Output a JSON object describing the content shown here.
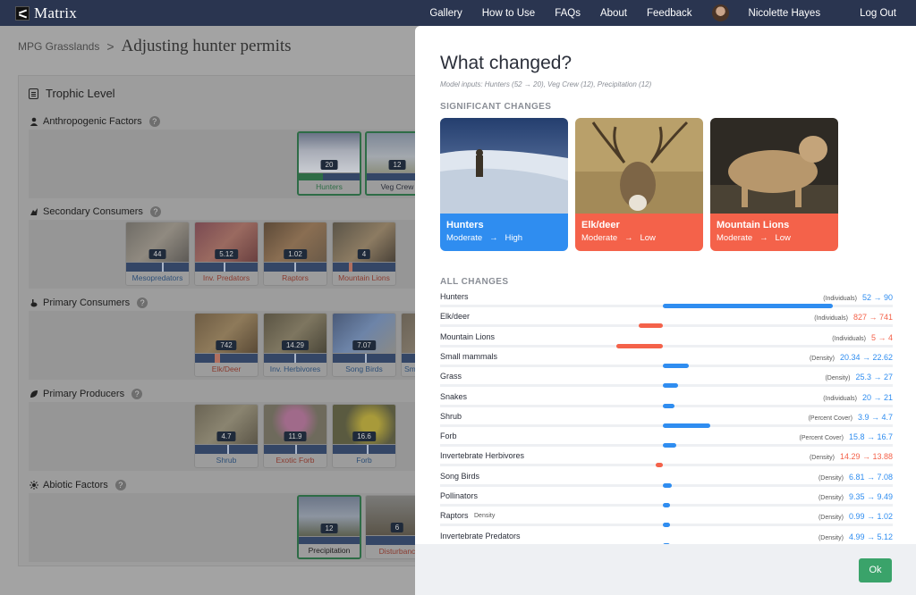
{
  "app": {
    "name": "Matrix"
  },
  "nav": {
    "items": [
      "Gallery",
      "How to Use",
      "FAQs",
      "About",
      "Feedback"
    ],
    "user_name": "Nicolette Hayes",
    "logout": "Log Out"
  },
  "breadcrumb": {
    "parent": "MPG Grasslands",
    "separator": ">",
    "current": "Adjusting hunter permits"
  },
  "trophic": {
    "title": "Trophic Level",
    "help": "?",
    "sections": [
      {
        "label": "Anthropogenic Factors"
      },
      {
        "label": "Secondary Consumers"
      },
      {
        "label": "Primary Consumers"
      },
      {
        "label": "Primary Producers"
      },
      {
        "label": "Abiotic Factors"
      }
    ],
    "tiles": {
      "anthro": [
        {
          "value": "20",
          "label": "Hunters"
        },
        {
          "value": "12",
          "label": "Veg Crew"
        }
      ],
      "secondary": [
        {
          "value": "44",
          "label": "Mesopredators"
        },
        {
          "value": "5.12",
          "label": "Inv. Predators"
        },
        {
          "value": "1.02",
          "label": "Raptors"
        },
        {
          "value": "4",
          "label": "Mountain Lions"
        }
      ],
      "primary": [
        {
          "value": "742",
          "label": "Elk/Deer"
        },
        {
          "value": "14.29",
          "label": "Inv. Herbivores"
        },
        {
          "value": "7.07",
          "label": "Song Birds"
        },
        {
          "value": "",
          "label": "Sm"
        }
      ],
      "producers": [
        {
          "value": "4.7",
          "label": "Shrub"
        },
        {
          "value": "11.9",
          "label": "Exotic Forb"
        },
        {
          "value": "16.6",
          "label": "Forb"
        }
      ],
      "abiotic": [
        {
          "value": "12",
          "label": "Precipitation"
        },
        {
          "value": "6",
          "label": "Disturbanc"
        }
      ]
    }
  },
  "modal": {
    "title": "What changed?",
    "inputs": "Model inputs: Hunters (52 → 20), Veg Crew (12),  Precipitation (12)",
    "significant_heading": "SIGNIFICANT CHANGES",
    "significant": [
      {
        "name": "Hunters",
        "from": "Moderate",
        "arrow": "→",
        "to": "High",
        "color": "#2f8df0"
      },
      {
        "name": "Elk/deer",
        "from": "Moderate",
        "arrow": "→",
        "to": "Low",
        "color": "#f4624a"
      },
      {
        "name": "Mountain Lions",
        "from": "Moderate",
        "arrow": "→",
        "to": "Low",
        "color": "#f4624a"
      }
    ],
    "all_heading": "ALL CHANGES",
    "changes": [
      {
        "name": "Hunters",
        "unit": "(Individuals)",
        "change": "52 → 90",
        "dir": "up"
      },
      {
        "name": "Elk/deer",
        "unit": "(Individuals)",
        "change": "827 → 741",
        "dir": "down"
      },
      {
        "name": "Mountain Lions",
        "unit": "(Individuals)",
        "change": "5 → 4",
        "dir": "down"
      },
      {
        "name": "Small mammals",
        "unit": "(Density)",
        "change": "20.34 → 22.62",
        "dir": "up"
      },
      {
        "name": "Grass",
        "unit": "(Density)",
        "change": "25.3 → 27",
        "dir": "up"
      },
      {
        "name": "Snakes",
        "unit": "(Individuals)",
        "change": "20 → 21",
        "dir": "up"
      },
      {
        "name": "Shrub",
        "unit": "(Percent Cover)",
        "change": "3.9 → 4.7",
        "dir": "up"
      },
      {
        "name": "Forb",
        "unit": "(Percent Cover)",
        "change": "15.8 → 16.7",
        "dir": "up"
      },
      {
        "name": "Invertebrate Herbivores",
        "unit": "(Density)",
        "change": "14.29 → 13.88",
        "dir": "down"
      },
      {
        "name": "Song Birds",
        "unit": "(Density)",
        "change": "6.81 → 7.08",
        "dir": "up"
      },
      {
        "name": "Pollinators",
        "unit": "(Density)",
        "change": "9.35 → 9.49",
        "dir": "up"
      },
      {
        "name": "Raptors",
        "name_note": "Density",
        "unit": "(Density)",
        "change": "0.99 → 1.02",
        "dir": "up"
      },
      {
        "name": "Invertebrate Predators",
        "unit": "(Density)",
        "change": "4.99 → 5.12",
        "dir": "up"
      }
    ],
    "ok": "Ok"
  },
  "colors": {
    "increase": "#2f8df0",
    "decrease": "#f4624a",
    "nav": "#2a3550",
    "ok": "#3aa36a"
  }
}
